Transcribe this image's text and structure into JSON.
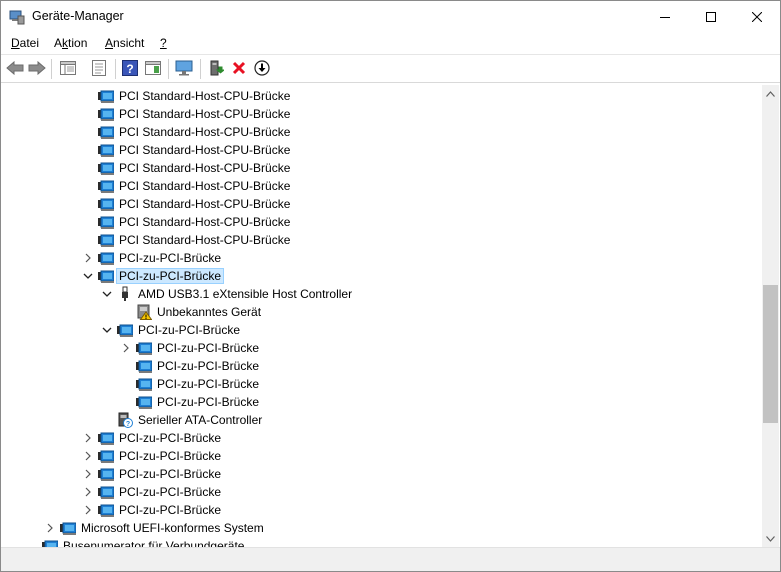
{
  "window": {
    "title": "Geräte-Manager"
  },
  "menu": [
    {
      "label": "Datei",
      "accel": "D"
    },
    {
      "label": "Aktion",
      "accel": "k"
    },
    {
      "label": "Ansicht",
      "accel": "A"
    },
    {
      "label": "?",
      "accel": "?"
    }
  ],
  "toolbar_icons": [
    "back-icon",
    "forward-icon",
    "properties-view-icon",
    "device-list-icon",
    "help-icon",
    "action-view-icon",
    "monitor-icon",
    "update-driver-icon",
    "uninstall-icon",
    "download-icon"
  ],
  "tree": [
    {
      "label": "PCI Standard-Host-CPU-Brücke",
      "level": 2,
      "expander": "none",
      "icon": "pci-device"
    },
    {
      "label": "PCI Standard-Host-CPU-Brücke",
      "level": 2,
      "expander": "none",
      "icon": "pci-device"
    },
    {
      "label": "PCI Standard-Host-CPU-Brücke",
      "level": 2,
      "expander": "none",
      "icon": "pci-device"
    },
    {
      "label": "PCI Standard-Host-CPU-Brücke",
      "level": 2,
      "expander": "none",
      "icon": "pci-device"
    },
    {
      "label": "PCI Standard-Host-CPU-Brücke",
      "level": 2,
      "expander": "none",
      "icon": "pci-device"
    },
    {
      "label": "PCI Standard-Host-CPU-Brücke",
      "level": 2,
      "expander": "none",
      "icon": "pci-device"
    },
    {
      "label": "PCI Standard-Host-CPU-Brücke",
      "level": 2,
      "expander": "none",
      "icon": "pci-device"
    },
    {
      "label": "PCI Standard-Host-CPU-Brücke",
      "level": 2,
      "expander": "none",
      "icon": "pci-device"
    },
    {
      "label": "PCI Standard-Host-CPU-Brücke",
      "level": 2,
      "expander": "none",
      "icon": "pci-device"
    },
    {
      "label": "PCI-zu-PCI-Brücke",
      "level": 2,
      "expander": "collapsed",
      "icon": "pci-device"
    },
    {
      "label": "PCI-zu-PCI-Brücke",
      "level": 2,
      "expander": "expanded",
      "icon": "pci-device",
      "selected": true
    },
    {
      "label": "AMD USB3.1 eXtensible Host Controller",
      "level": 3,
      "expander": "expanded",
      "icon": "usb"
    },
    {
      "label": "Unbekanntes Gerät",
      "level": 4,
      "expander": "none",
      "icon": "warning-device"
    },
    {
      "label": "PCI-zu-PCI-Brücke",
      "level": 3,
      "expander": "expanded",
      "icon": "pci-device"
    },
    {
      "label": "PCI-zu-PCI-Brücke",
      "level": 4,
      "expander": "collapsed",
      "icon": "pci-device"
    },
    {
      "label": "PCI-zu-PCI-Brücke",
      "level": 4,
      "expander": "none",
      "icon": "pci-device"
    },
    {
      "label": "PCI-zu-PCI-Brücke",
      "level": 4,
      "expander": "none",
      "icon": "pci-device"
    },
    {
      "label": "PCI-zu-PCI-Brücke",
      "level": 4,
      "expander": "none",
      "icon": "pci-device"
    },
    {
      "label": "Serieller ATA-Controller",
      "level": 3,
      "expander": "none",
      "icon": "unknown-device"
    },
    {
      "label": "PCI-zu-PCI-Brücke",
      "level": 2,
      "expander": "collapsed",
      "icon": "pci-device"
    },
    {
      "label": "PCI-zu-PCI-Brücke",
      "level": 2,
      "expander": "collapsed",
      "icon": "pci-device"
    },
    {
      "label": "PCI-zu-PCI-Brücke",
      "level": 2,
      "expander": "collapsed",
      "icon": "pci-device"
    },
    {
      "label": "PCI-zu-PCI-Brücke",
      "level": 2,
      "expander": "collapsed",
      "icon": "pci-device"
    },
    {
      "label": "PCI-zu-PCI-Brücke",
      "level": 2,
      "expander": "collapsed",
      "icon": "pci-device"
    },
    {
      "label": "Microsoft UEFI-konformes System",
      "level": 0,
      "expander": "collapsed",
      "icon": "pci-device"
    },
    {
      "label": "Busenumerator für Verbundgeräte",
      "level": -1,
      "expander": "none",
      "icon": "pci-device"
    }
  ],
  "colors": {
    "selection": "#cce8ff",
    "selection_border": "#99d1ff",
    "icon_blue": "#1e7fd4",
    "uninstall_red": "#e81123",
    "update_green": "#2e8b2e"
  }
}
